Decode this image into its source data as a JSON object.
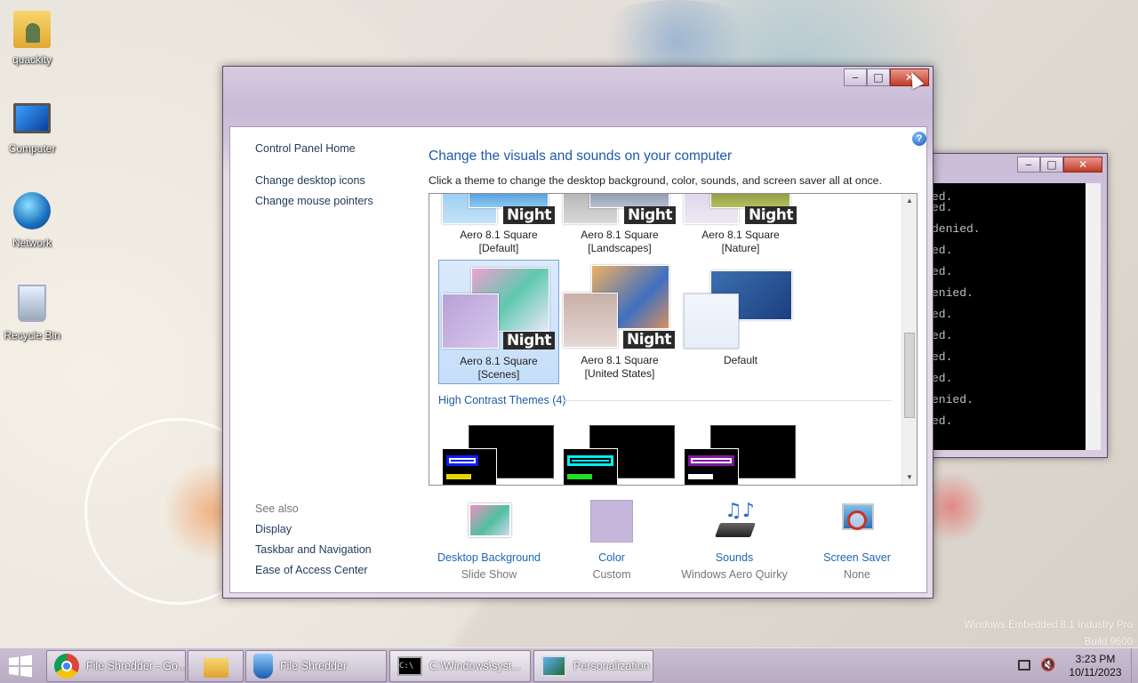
{
  "desktop": {
    "icons": [
      {
        "label": "quackity",
        "icon": "user-folder-icon"
      },
      {
        "label": "Computer",
        "icon": "computer-icon"
      },
      {
        "label": "Network",
        "icon": "network-icon"
      },
      {
        "label": "Recycle Bin",
        "icon": "recycle-bin-icon"
      }
    ],
    "watermark": {
      "line1": "Windows Embedded 8.1 Industry Pro",
      "line2": "Build 9600"
    }
  },
  "window": {
    "title_buttons": {
      "minimize": "‒",
      "maximize": "□",
      "close": "✕"
    },
    "left_nav": {
      "home": "Control Panel Home",
      "links": [
        "Change desktop icons",
        "Change mouse pointers"
      ],
      "see_also_title": "See also",
      "see_also": [
        "Display",
        "Taskbar and Navigation",
        "Ease of Access Center"
      ]
    },
    "heading": "Change the visuals and sounds on your computer",
    "subheading": "Click a theme to change the desktop background, color, sounds, and screen saver all at once.",
    "help": "?",
    "themes": {
      "night_badge": "Night",
      "row1": [
        {
          "line1": "Aero 8.1 Square",
          "line2": "[Default]"
        },
        {
          "line1": "Aero 8.1 Square",
          "line2": "[Landscapes]"
        },
        {
          "line1": "Aero 8.1 Square",
          "line2": "[Nature]"
        }
      ],
      "row2": [
        {
          "line1": "Aero 8.1 Square",
          "line2": "[Scenes]",
          "selected": true
        },
        {
          "line1": "Aero 8.1 Square",
          "line2": "[United States]"
        },
        {
          "line1": "Default",
          "line2": ""
        }
      ],
      "high_contrast_label": "High Contrast Themes (4)"
    },
    "bottom": [
      {
        "label": "Desktop Background",
        "value": "Slide Show",
        "icon": "desktop-background-icon"
      },
      {
        "label": "Color",
        "value": "Custom",
        "icon": "color-swatch-icon",
        "color": "#c7b6dc"
      },
      {
        "label": "Sounds",
        "value": "Windows Aero Quirky",
        "icon": "sounds-icon"
      },
      {
        "label": "Screen Saver",
        "value": "None",
        "icon": "screen-saver-icon"
      }
    ]
  },
  "cmd": {
    "title_buttons": {
      "minimize": "‒",
      "maximize": "□",
      "close": "✕"
    },
    "lines": [
      "ed.",
      "ed.",
      "denied.",
      "ed.",
      "ed.",
      "enied.",
      "ed.",
      "ed.",
      "ed.",
      "ed.",
      "enied.",
      "ed."
    ]
  },
  "taskbar": {
    "items": [
      {
        "label": "File Shredder - Go...",
        "icon": "chrome-icon"
      },
      {
        "label": "",
        "icon": "file-explorer-icon"
      },
      {
        "label": "File Shredder",
        "icon": "file-shredder-icon"
      },
      {
        "label": "C:\\Windows\\syst...",
        "icon": "cmd-icon"
      },
      {
        "label": "Personalization",
        "icon": "personalization-icon"
      }
    ],
    "clock": {
      "time": "3:23 PM",
      "date": "10/11/2023"
    }
  },
  "colors": {
    "accent_link": "#1e66b8",
    "heading": "#1e5aa8",
    "taskbar": "#bdb1c7"
  }
}
